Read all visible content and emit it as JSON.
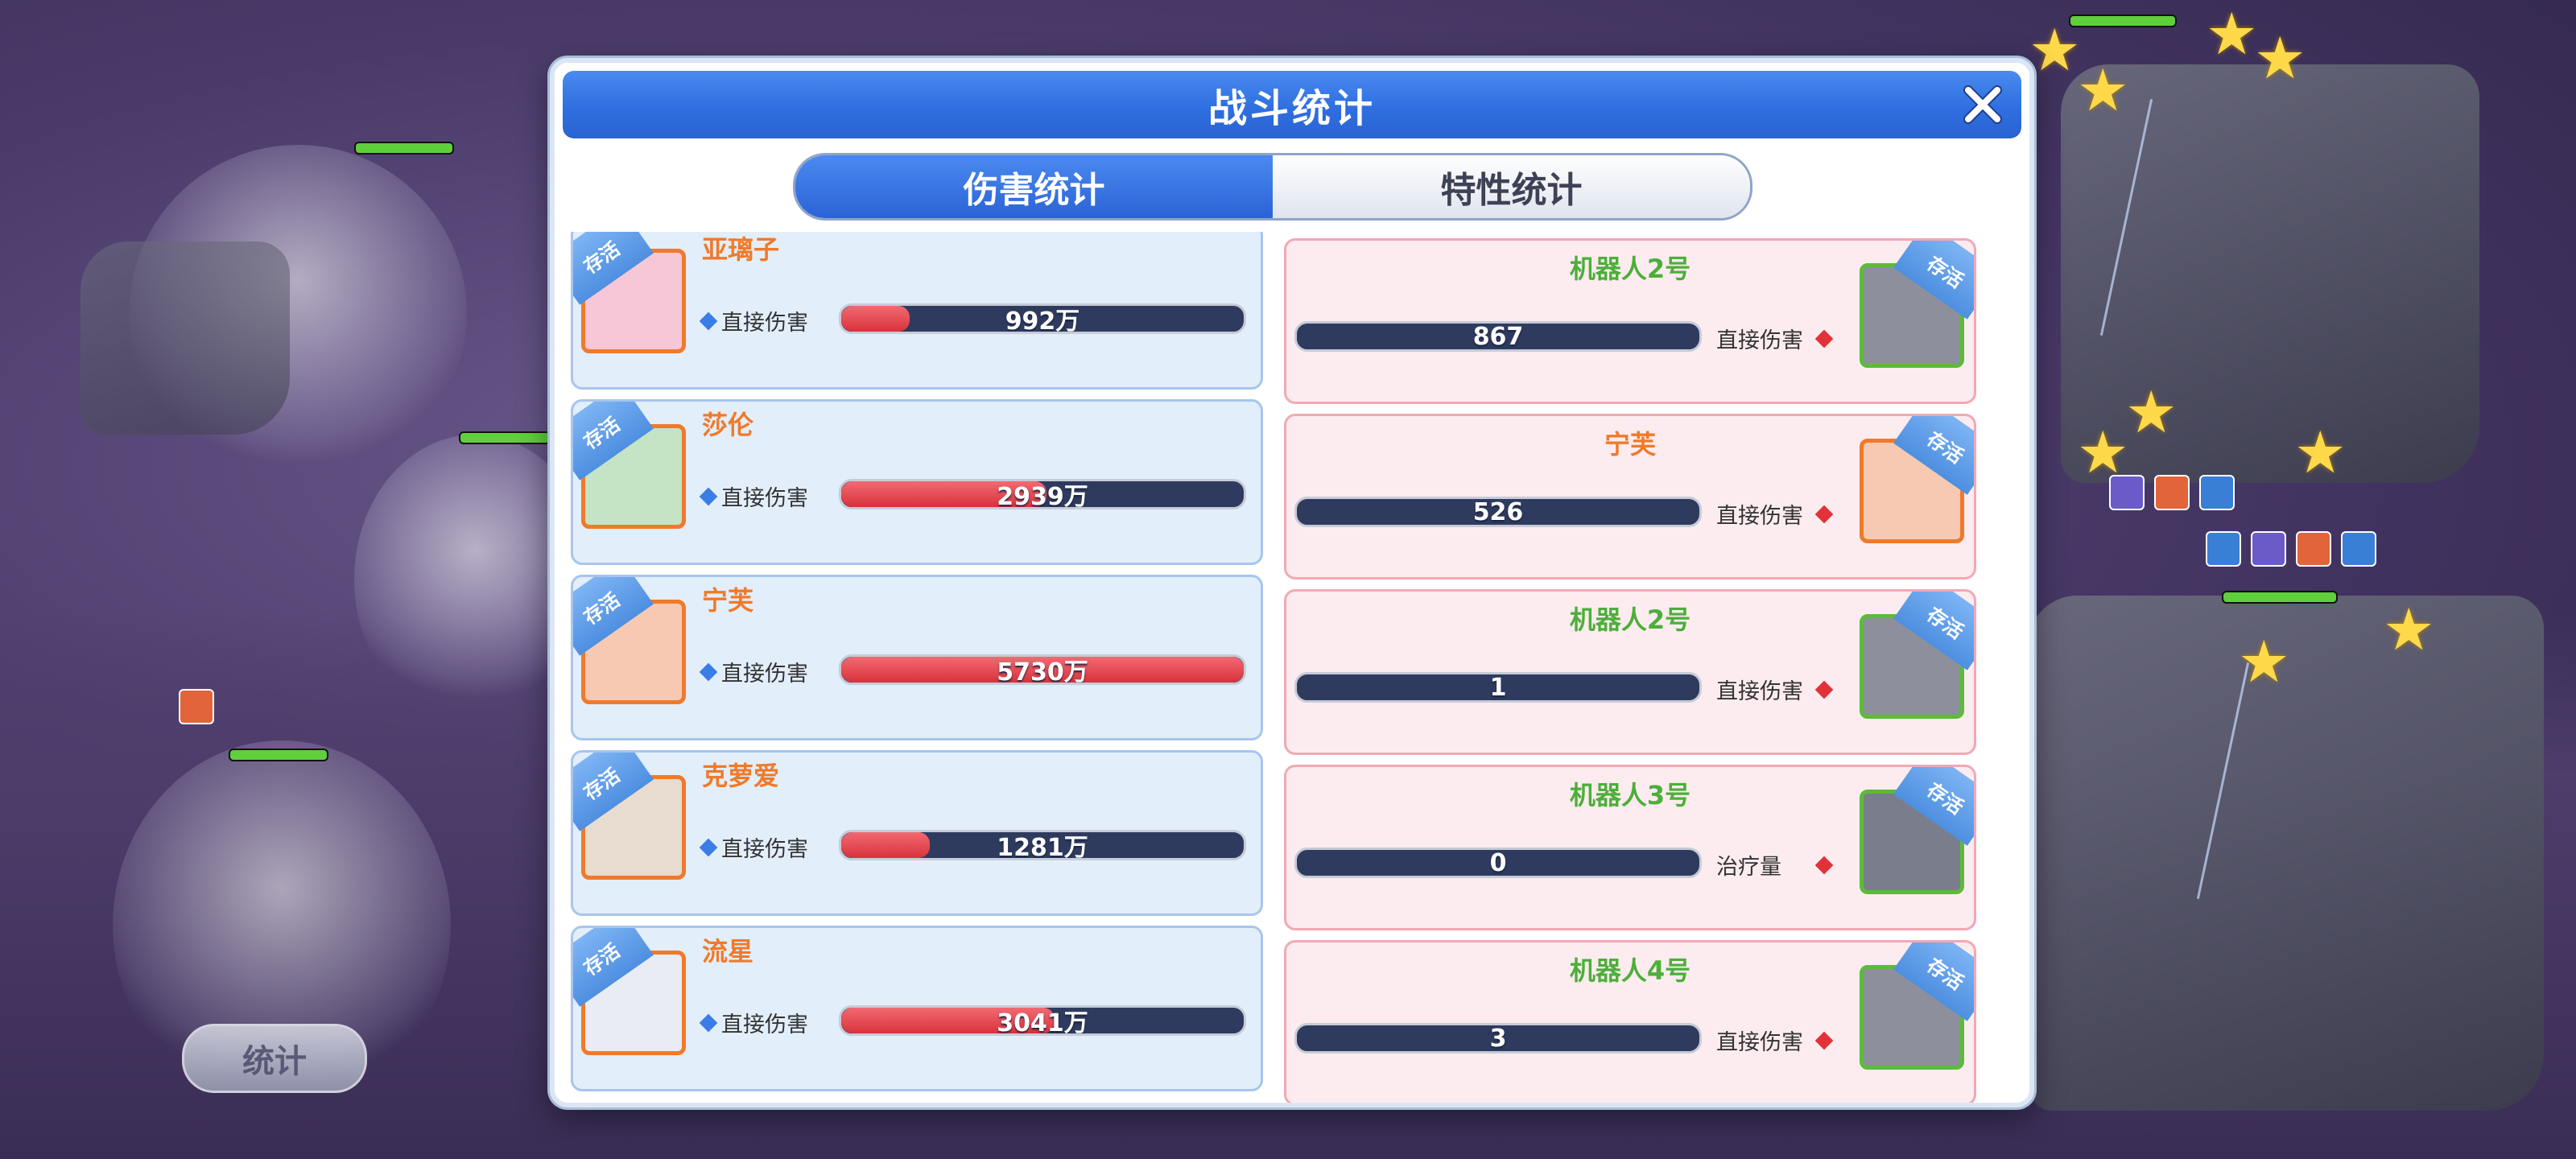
{
  "dialog": {
    "title": "战斗统计",
    "tabs": [
      {
        "label": "伤害统计",
        "active": true
      },
      {
        "label": "特性统计",
        "active": false
      }
    ]
  },
  "scene": {
    "stat_button_label": "统计"
  },
  "allies": [
    {
      "name": "亚璃子",
      "badge": "存活",
      "stat_label": "直接伤害",
      "value_text": "992万",
      "fill": 0.17
    },
    {
      "name": "莎伦",
      "badge": "存活",
      "stat_label": "直接伤害",
      "value_text": "2939万",
      "fill": 0.51
    },
    {
      "name": "宁芙",
      "badge": "存活",
      "stat_label": "直接伤害",
      "value_text": "5730万",
      "fill": 1.0
    },
    {
      "name": "克萝爱",
      "badge": "存活",
      "stat_label": "直接伤害",
      "value_text": "1281万",
      "fill": 0.22
    },
    {
      "name": "流星",
      "badge": "存活",
      "stat_label": "直接伤害",
      "value_text": "3041万",
      "fill": 0.53
    }
  ],
  "enemies": [
    {
      "name": "机器人2号",
      "name_color": "#4caf3a",
      "badge": "存活",
      "stat_label": "直接伤害",
      "value_text": "867",
      "fill": 0.0
    },
    {
      "name": "宁芙",
      "name_color": "#f07a2a",
      "badge": "存活",
      "stat_label": "直接伤害",
      "value_text": "526",
      "fill": 0.0
    },
    {
      "name": "机器人2号",
      "name_color": "#4caf3a",
      "badge": "存活",
      "stat_label": "直接伤害",
      "value_text": "1",
      "fill": 0.0
    },
    {
      "name": "机器人3号",
      "name_color": "#4caf3a",
      "badge": "存活",
      "stat_label": "治疗量",
      "value_text": "0",
      "fill": 0.0
    },
    {
      "name": "机器人4号",
      "name_color": "#4caf3a",
      "badge": "存活",
      "stat_label": "直接伤害",
      "value_text": "3",
      "fill": 0.0
    }
  ],
  "icons": {
    "close": "close-icon",
    "ally_marker": "blue-diamond-icon",
    "enemy_marker": "red-diamond-icon"
  },
  "colors": {
    "header_blue": "#2f6fe0",
    "ally_name": "#f07a2a",
    "enemy_name_robot": "#4caf3a",
    "bar_fill": "#d8323b",
    "bar_track": "#2f3b5e"
  }
}
